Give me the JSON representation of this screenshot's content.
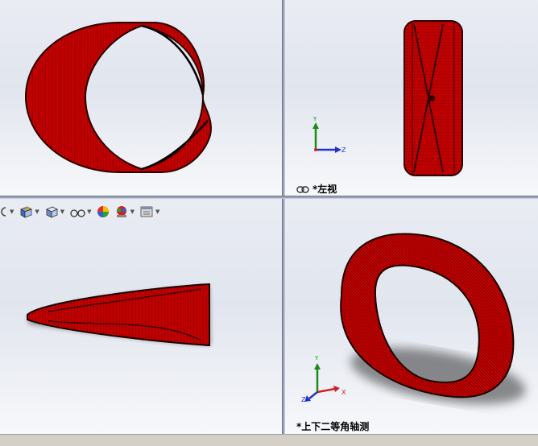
{
  "viewports": {
    "top_left": {
      "label": ""
    },
    "top_right": {
      "label": "*左视"
    },
    "bottom_left": {
      "label": ""
    },
    "bottom_right": {
      "label": "*上下二等角轴测"
    }
  },
  "triad": {
    "axis_y": "Y",
    "axis_z": "Z",
    "axis_x": "X"
  },
  "toolbar": {
    "items": [
      "rotate-view-icon",
      "view-orientation-icon",
      "display-style-icon",
      "hide-show-icon",
      "edit-appearance-icon",
      "apply-scene-icon",
      "view-settings-icon"
    ]
  },
  "colors": {
    "model": "#c00000",
    "model_edge": "#2a0000",
    "axis_y": "#1a8a1a",
    "axis_z": "#2233cc",
    "axis_x": "#cc2222"
  }
}
